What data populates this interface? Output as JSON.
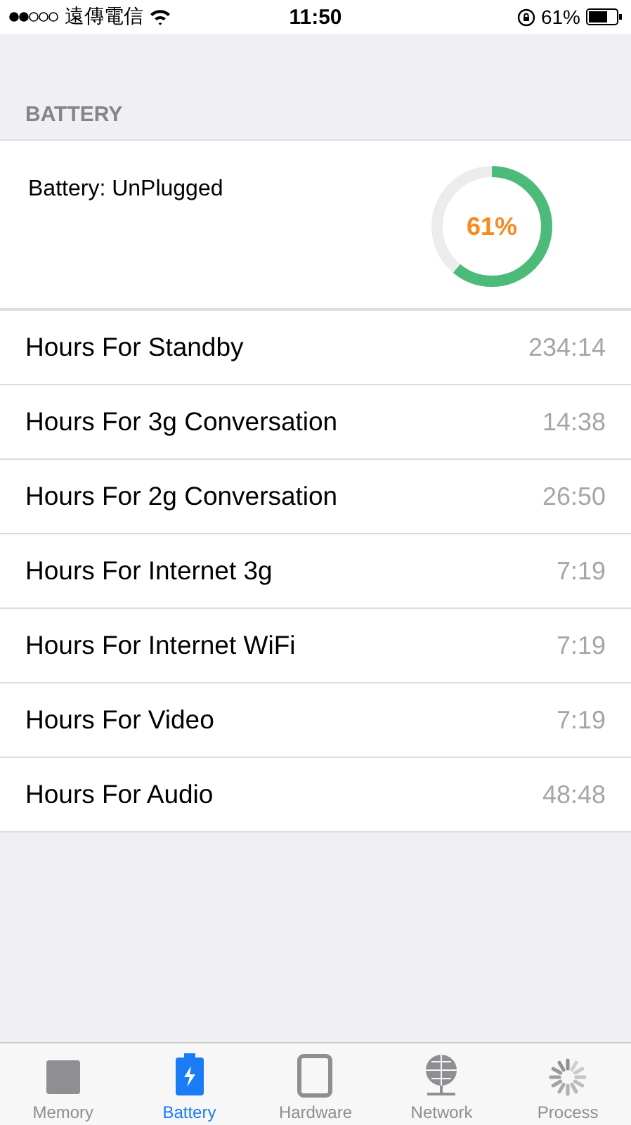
{
  "status_bar": {
    "carrier": "遠傳電信",
    "time": "11:50",
    "battery": "61%"
  },
  "section": {
    "title": "BATTERY"
  },
  "summary": {
    "label": "Battery: UnPlugged",
    "percent": "61%",
    "level": 0.61
  },
  "rows": [
    {
      "label": "Hours For Standby",
      "value": "234:14"
    },
    {
      "label": "Hours For 3g Conversation",
      "value": "14:38"
    },
    {
      "label": "Hours For 2g Conversation",
      "value": "26:50"
    },
    {
      "label": "Hours For Internet 3g",
      "value": "7:19"
    },
    {
      "label": "Hours For Internet WiFi",
      "value": "7:19"
    },
    {
      "label": "Hours For Video",
      "value": "7:19"
    },
    {
      "label": "Hours For Audio",
      "value": "48:48"
    }
  ],
  "tabs": [
    {
      "label": "Memory",
      "kind": "memory",
      "selected": false
    },
    {
      "label": "Battery",
      "kind": "battery",
      "selected": true
    },
    {
      "label": "Hardware",
      "kind": "hardware",
      "selected": false
    },
    {
      "label": "Network",
      "kind": "network",
      "selected": false
    },
    {
      "label": "Process",
      "kind": "process",
      "selected": false
    }
  ]
}
